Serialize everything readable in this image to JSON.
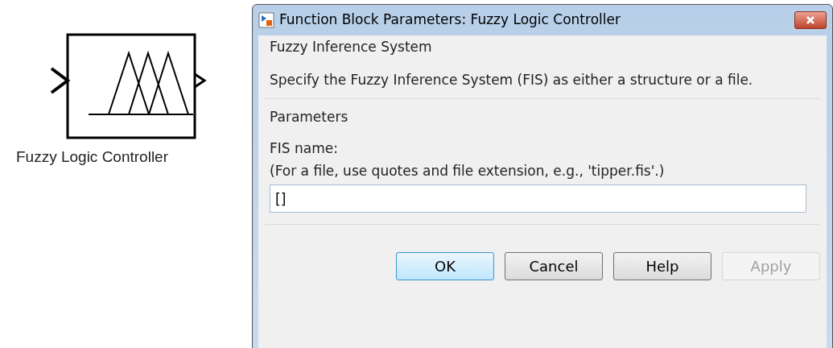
{
  "block": {
    "label": "Fuzzy Logic Controller"
  },
  "dialog": {
    "title": "Function Block Parameters: Fuzzy Logic Controller",
    "sections": [
      {
        "title": "Fuzzy Inference System",
        "description": "Specify the Fuzzy Inference System (FIS) as either a structure or a file."
      },
      {
        "title": "Parameters",
        "field_label": "FIS name:",
        "field_hint": "(For a file, use quotes and file extension, e.g., 'tipper.fis'.)",
        "field_value": "[]"
      }
    ],
    "buttons": [
      {
        "label": "OK",
        "default": true,
        "disabled": false
      },
      {
        "label": "Cancel",
        "default": false,
        "disabled": false
      },
      {
        "label": "Help",
        "default": false,
        "disabled": false
      },
      {
        "label": "Apply",
        "default": false,
        "disabled": true
      }
    ]
  }
}
